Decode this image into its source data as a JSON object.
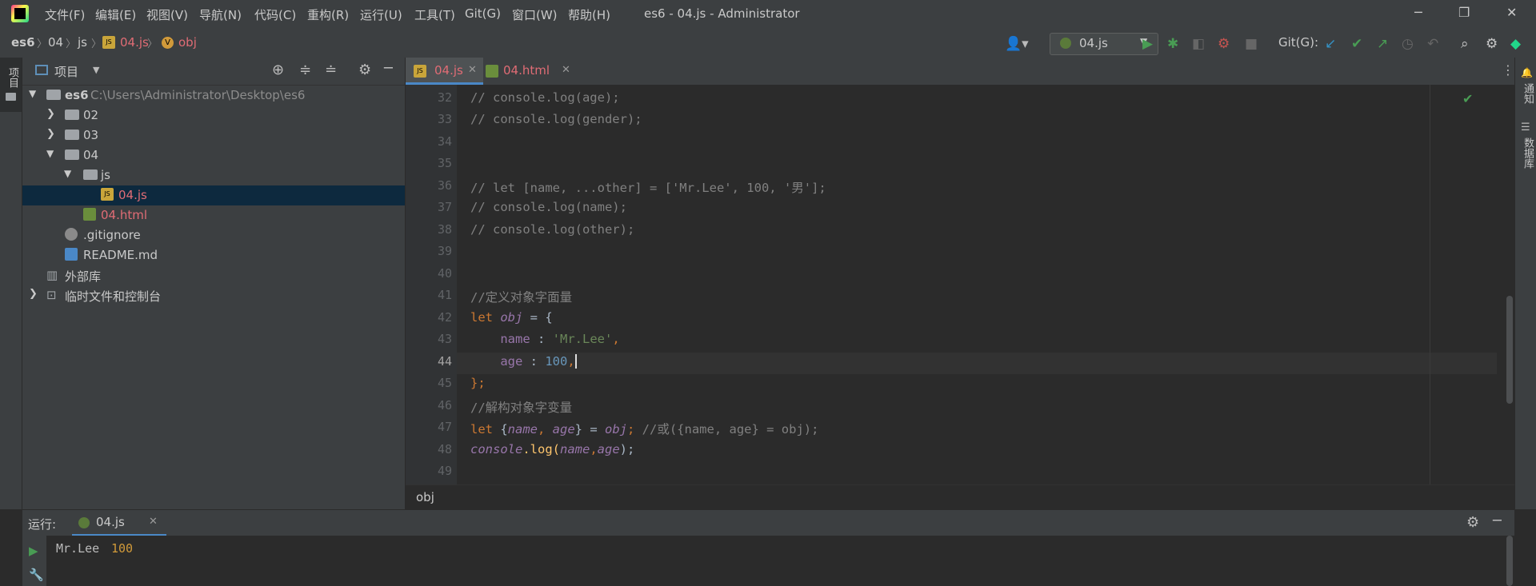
{
  "window": {
    "title": "es6 - 04.js - Administrator",
    "menu": [
      "文件(F)",
      "编辑(E)",
      "视图(V)",
      "导航(N)",
      "代码(C)",
      "重构(R)",
      "运行(U)",
      "工具(T)",
      "Git(G)",
      "窗口(W)",
      "帮助(H)"
    ]
  },
  "breadcrumb": [
    "es6",
    "04",
    "js",
    "04.js",
    "obj"
  ],
  "toolbar": {
    "run_config": "04.js",
    "git_label": "Git(G):"
  },
  "left_strip": {
    "project_tab": "项目"
  },
  "right_strip": {
    "notifications": "通知",
    "database": "数据库"
  },
  "project": {
    "title": "项目",
    "tree": [
      {
        "label": "es6",
        "path": "C:\\Users\\Administrator\\Desktop\\es6"
      },
      {
        "label": "02"
      },
      {
        "label": "03"
      },
      {
        "label": "04"
      },
      {
        "label": "js"
      },
      {
        "label": "04.js"
      },
      {
        "label": "04.html"
      },
      {
        "label": ".gitignore"
      },
      {
        "label": "README.md"
      },
      {
        "label": "外部库"
      },
      {
        "label": "临时文件和控制台"
      }
    ]
  },
  "editor": {
    "tabs": [
      {
        "label": "04.js"
      },
      {
        "label": "04.html"
      }
    ],
    "line_numbers": [
      "32",
      "33",
      "34",
      "35",
      "36",
      "37",
      "38",
      "39",
      "40",
      "41",
      "42",
      "43",
      "44",
      "45",
      "46",
      "47",
      "48",
      "49"
    ],
    "code_lines": [
      {
        "n": "32",
        "text": "// console.log(age);"
      },
      {
        "n": "33",
        "text": "// console.log(gender);"
      },
      {
        "n": "36",
        "text": "// let [name, ...other] = ['Mr.Lee', 100, '男'];"
      },
      {
        "n": "37",
        "text": "// console.log(name);"
      },
      {
        "n": "38",
        "text": "// console.log(other);"
      },
      {
        "n": "41",
        "text": "//定义对象字面量"
      },
      {
        "n": "46",
        "text": "//解构对象字变量"
      }
    ],
    "tokens": {
      "let": "let",
      "obj": "obj",
      "eq_brace": " = {",
      "name": "name",
      "colon": " : ",
      "mrlee": "'Mr.Lee'",
      "comma": ",",
      "age": "age",
      "hundred": "100",
      "close": "};",
      "l47_open": " {",
      "l47_sep": ", ",
      "l47_close": "} = ",
      "l47_semi": "; ",
      "l47_comment": "//或({name, age} = obj);",
      "console": "console",
      "dot_log": ".log(",
      "l48_comma": ",",
      "l48_close": ");"
    },
    "footer_crumb": "obj"
  },
  "run": {
    "label": "运行:",
    "tab": "04.js",
    "output_text": "Mr.Lee",
    "output_num": "100"
  }
}
